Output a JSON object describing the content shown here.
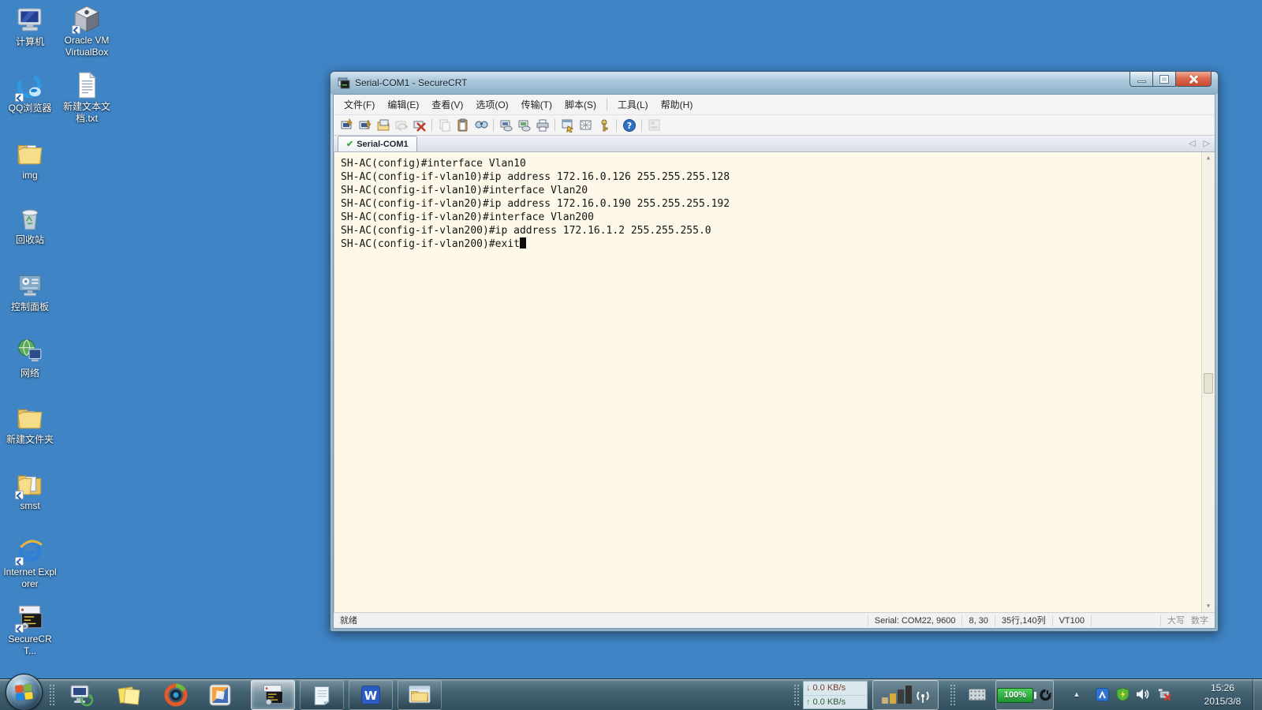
{
  "colors": {
    "desktop_bg": "#3f85c6",
    "terminal_bg": "#fdf8e7",
    "title_glass": "#a9c6da",
    "close_button_red": "#c84a31",
    "battery_green": "#2fae3e",
    "tab_check_green": "#3faa3f"
  },
  "desktop": {
    "icons": [
      {
        "name": "computer",
        "label": "计算机"
      },
      {
        "name": "virtualbox",
        "label": "Oracle VM VirtualBox"
      },
      {
        "name": "qq-browser",
        "label": "QQ浏览器"
      },
      {
        "name": "text-document",
        "label": "新建文本文档.txt"
      },
      {
        "name": "img-folder",
        "label": "img"
      },
      {
        "name": "recycle-bin",
        "label": "回收站"
      },
      {
        "name": "control-panel",
        "label": "控制面板"
      },
      {
        "name": "network",
        "label": "网络"
      },
      {
        "name": "new-folder",
        "label": "新建文件夹"
      },
      {
        "name": "smst-folder",
        "label": "smst"
      },
      {
        "name": "internet-explorer",
        "label": "Internet Explorer"
      },
      {
        "name": "securecrt-shortcut",
        "label": "SecureCRT..."
      }
    ]
  },
  "window": {
    "title": "Serial-COM1 - SecureCRT",
    "menus": [
      "文件(F)",
      "编辑(E)",
      "查看(V)",
      "选项(O)",
      "传输(T)",
      "脚本(S)",
      "工具(L)",
      "帮助(H)"
    ],
    "tab": {
      "label": "Serial-COM1"
    },
    "terminal": {
      "lines": [
        "SH-AC(config)#interface Vlan10",
        "SH-AC(config-if-vlan10)#ip address 172.16.0.126 255.255.255.128",
        "SH-AC(config-if-vlan10)#interface Vlan20",
        "SH-AC(config-if-vlan20)#ip address 172.16.0.190 255.255.255.192",
        "SH-AC(config-if-vlan20)#interface Vlan200",
        "SH-AC(config-if-vlan200)#ip address 172.16.1.2 255.255.255.0",
        "SH-AC(config-if-vlan200)#exit"
      ]
    },
    "statusbar": {
      "ready": "就绪",
      "serial": "Serial: COM22, 9600",
      "position": "8, 30",
      "dimensions": "35行,140列",
      "emulation": "VT100",
      "caps_lock": "大写",
      "num_lock": "数字"
    }
  },
  "taskbar": {
    "tray": {
      "download_speed": "0.0 KB/s",
      "upload_speed": "0.0 KB/s",
      "battery_level": "100%",
      "time": "15:26",
      "date": "2015/3/8"
    }
  },
  "icons": {
    "tab_check": "✔",
    "tab_prev": "◁",
    "tab_next": "▷",
    "scroll_up": "▲",
    "scroll_down": "▼",
    "hidden_tray": "▲",
    "download_arrow": "↓",
    "upload_arrow": "↑"
  }
}
